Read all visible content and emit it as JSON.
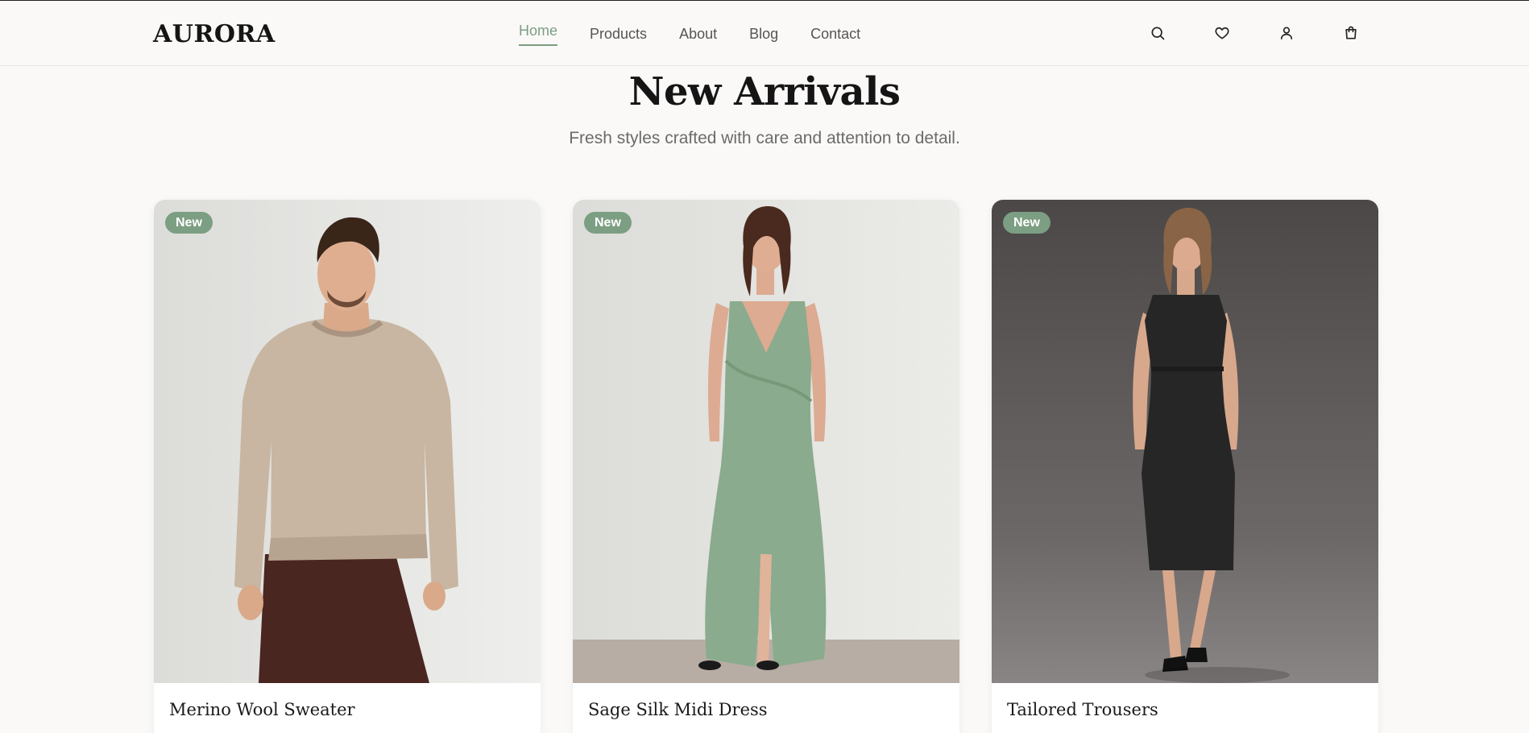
{
  "brand": {
    "logo": "AURORA"
  },
  "nav": {
    "items": [
      {
        "label": "Home",
        "active": true
      },
      {
        "label": "Products",
        "active": false
      },
      {
        "label": "About",
        "active": false
      },
      {
        "label": "Blog",
        "active": false
      },
      {
        "label": "Contact",
        "active": false
      }
    ]
  },
  "header_icons": [
    "search-icon",
    "heart-icon",
    "user-icon",
    "shopping-bag-icon"
  ],
  "hero": {
    "title": "New Arrivals",
    "subtitle": "Fresh styles crafted with care and attention to detail."
  },
  "products": [
    {
      "badge": "New",
      "name": "Merino Wool Sweater",
      "image": "man in beige sweater and brown trousers"
    },
    {
      "badge": "New",
      "name": "Sage Silk Midi Dress",
      "image": "woman in sage green wrap gown"
    },
    {
      "badge": "New",
      "name": "Tailored Trousers",
      "image": "woman in black midi dress on dark backdrop"
    }
  ],
  "colors": {
    "accent": "#7c9e82",
    "background": "#faf9f7",
    "text": "#1a1a1a",
    "muted": "#6b6b6b"
  }
}
